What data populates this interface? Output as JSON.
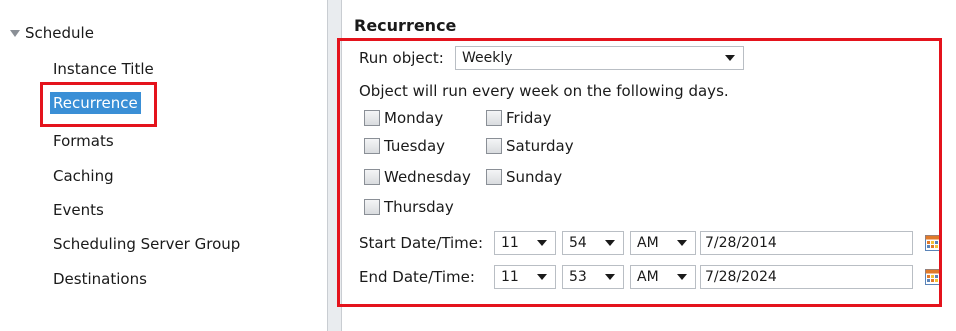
{
  "nav": {
    "root_label": "Schedule",
    "items": [
      {
        "label": "Instance Title"
      },
      {
        "label": "Recurrence",
        "selected": true
      },
      {
        "label": "Formats"
      },
      {
        "label": "Caching"
      },
      {
        "label": "Events"
      },
      {
        "label": "Scheduling Server Group"
      },
      {
        "label": "Destinations"
      }
    ]
  },
  "recurrence": {
    "section_title": "Recurrence",
    "run_object_label": "Run object:",
    "run_object_value": "Weekly",
    "days_caption": "Object will run every week on the following days.",
    "days": {
      "monday": "Monday",
      "tuesday": "Tuesday",
      "wednesday": "Wednesday",
      "thursday": "Thursday",
      "friday": "Friday",
      "saturday": "Saturday",
      "sunday": "Sunday"
    },
    "start": {
      "label": "Start Date/Time:",
      "hour": "11",
      "minute": "54",
      "ampm": "AM",
      "date": "7/28/2014"
    },
    "end": {
      "label": "End Date/Time:",
      "hour": "11",
      "minute": "53",
      "ampm": "AM",
      "date": "7/28/2024"
    }
  },
  "colors": {
    "highlight_red": "#e4131c",
    "selection_blue": "#3a8fd6"
  },
  "icons": {
    "tree_toggle": "triangle-down-icon",
    "calendar": "calendar-icon"
  }
}
